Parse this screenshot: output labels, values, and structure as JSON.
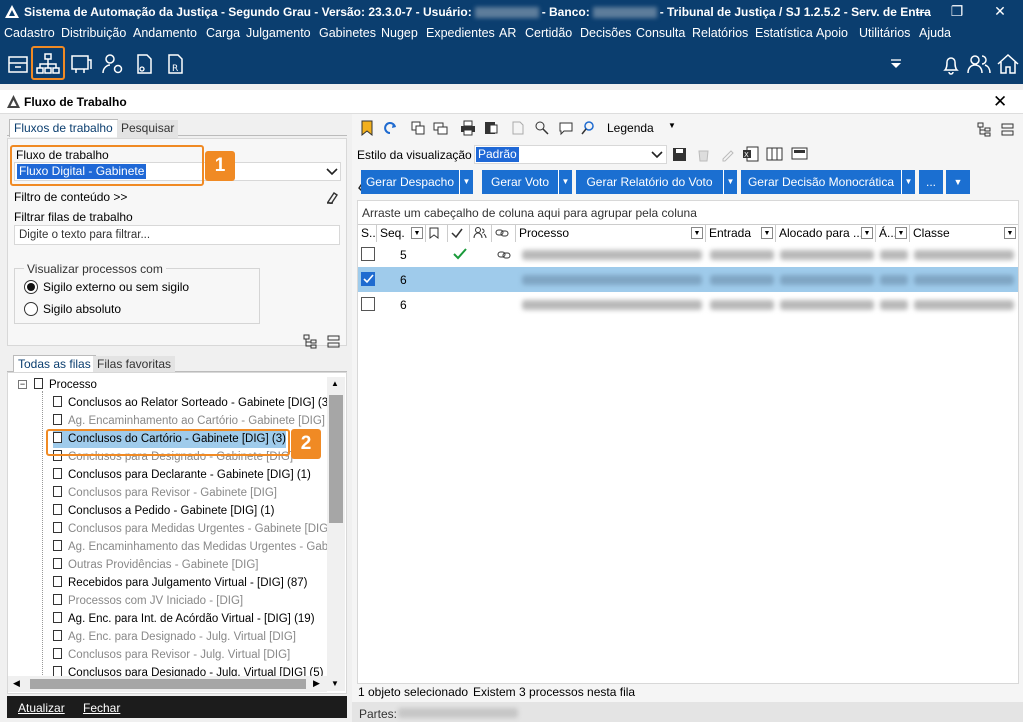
{
  "titlebar": {
    "title_prefix": "Sistema de Automação da Justiça - Segundo Grau - Versão: 23.3.0-7 - Usuário:",
    "banco_label": "- Banco:",
    "title_suffix": "- Tribunal de Justiça / SJ 1.2.5.2 - Serv. de Entra",
    "minimize": "—",
    "restore": "❐",
    "close": "✕"
  },
  "menu": [
    "Cadastro",
    "Distribuição",
    "Andamento",
    "Carga",
    "Julgamento",
    "Gabinetes",
    "Nugep",
    "Expedientes",
    "AR",
    "Certidão",
    "Decisões",
    "Consulta",
    "Relatórios",
    "Estatística",
    "Apoio",
    "Utilitários",
    "Ajuda"
  ],
  "toolbar": {
    "icons": [
      "drawer-icon",
      "workflow-icon",
      "screen-icon",
      "user-settings-icon",
      "document-icon",
      "document-r-icon"
    ],
    "right_icons": [
      "dropdown-arrow-icon",
      "bell-icon",
      "users-icon",
      "home-icon"
    ]
  },
  "window": {
    "title": "Fluxo de Trabalho",
    "close": "✕"
  },
  "left": {
    "tabs": [
      "Fluxos de trabalho",
      "Pesquisar"
    ],
    "fluxo_label": "Fluxo de trabalho",
    "fluxo_value": "Fluxo Digital - Gabinete",
    "filtro_conteudo": "Filtro de conteúdo >>",
    "filtrar_label": "Filtrar filas de trabalho",
    "filtrar_placeholder": "Digite o texto para filtrar...",
    "visualizar_label": "Visualizar processos com",
    "radio1": "Sigilo externo ou sem sigilo",
    "radio2": "Sigilo absoluto",
    "tree_tabs": [
      "Todas as filas",
      "Filas favoritas"
    ],
    "tree_root": "Processo",
    "tree_items": [
      {
        "label": "Conclusos ao Relator Sorteado - Gabinete [DIG] (3",
        "gray": false
      },
      {
        "label": "Ag. Encaminhamento ao Cartório - Gabinete [DIG]",
        "gray": true
      },
      {
        "label": "Conclusos do Cartório - Gabinete [DIG] (3)",
        "gray": false
      },
      {
        "label": "Conclusos para Designado - Gabinete [DIG]",
        "gray": true
      },
      {
        "label": "Conclusos para Declarante - Gabinete [DIG] (1)",
        "gray": false
      },
      {
        "label": "Conclusos para Revisor - Gabinete [DIG]",
        "gray": true
      },
      {
        "label": "Conclusos a Pedido - Gabinete [DIG] (1)",
        "gray": false
      },
      {
        "label": "Conclusos para Medidas Urgentes - Gabinete [DIG",
        "gray": true
      },
      {
        "label": "Ag. Encaminhamento das Medidas Urgentes - Gab",
        "gray": true
      },
      {
        "label": "Outras Providências - Gabinete [DIG]",
        "gray": true
      },
      {
        "label": "Recebidos para Julgamento Virtual - [DIG] (87)",
        "gray": false
      },
      {
        "label": "Processos com JV Iniciado - [DIG]",
        "gray": true
      },
      {
        "label": "Ag. Enc. para Int. de Acórdão Virtual - [DIG] (19)",
        "gray": false
      },
      {
        "label": "Ag. Enc. para Designado - Julg. Virtual [DIG]",
        "gray": true
      },
      {
        "label": "Conclusos para Revisor - Julg. Virtual [DIG]",
        "gray": true
      },
      {
        "label": "Conclusos para Designado - Julg. Virtual [DIG] (5)",
        "gray": false
      }
    ],
    "atualizar": "Atualizar",
    "fechar": "Fechar"
  },
  "badges": {
    "one": "1",
    "two": "2"
  },
  "right": {
    "legenda": "Legenda",
    "estilo_label": "Estilo da visualização",
    "estilo_value": "Padrão",
    "buttons": [
      "Gerar Despacho",
      "Gerar Voto",
      "Gerar Relatório do Voto",
      "Gerar Decisão Monocrática",
      "..."
    ],
    "group_hint": "Arraste um cabeçalho de coluna aqui para agrupar pela coluna",
    "columns": [
      "S...",
      "Seq.",
      "",
      "",
      "",
      "",
      "Processo",
      "Entrada",
      "Alocado para ...",
      "Á...",
      "Classe"
    ],
    "rows": [
      {
        "seq": "5",
        "checked": false,
        "selected": false
      },
      {
        "seq": "6",
        "checked": true,
        "selected": true
      },
      {
        "seq": "6",
        "checked": false,
        "selected": false
      }
    ],
    "status1": "1 objeto selecionado",
    "status2": "Existem 3 processos nesta fila",
    "partes_label": "Partes:"
  }
}
